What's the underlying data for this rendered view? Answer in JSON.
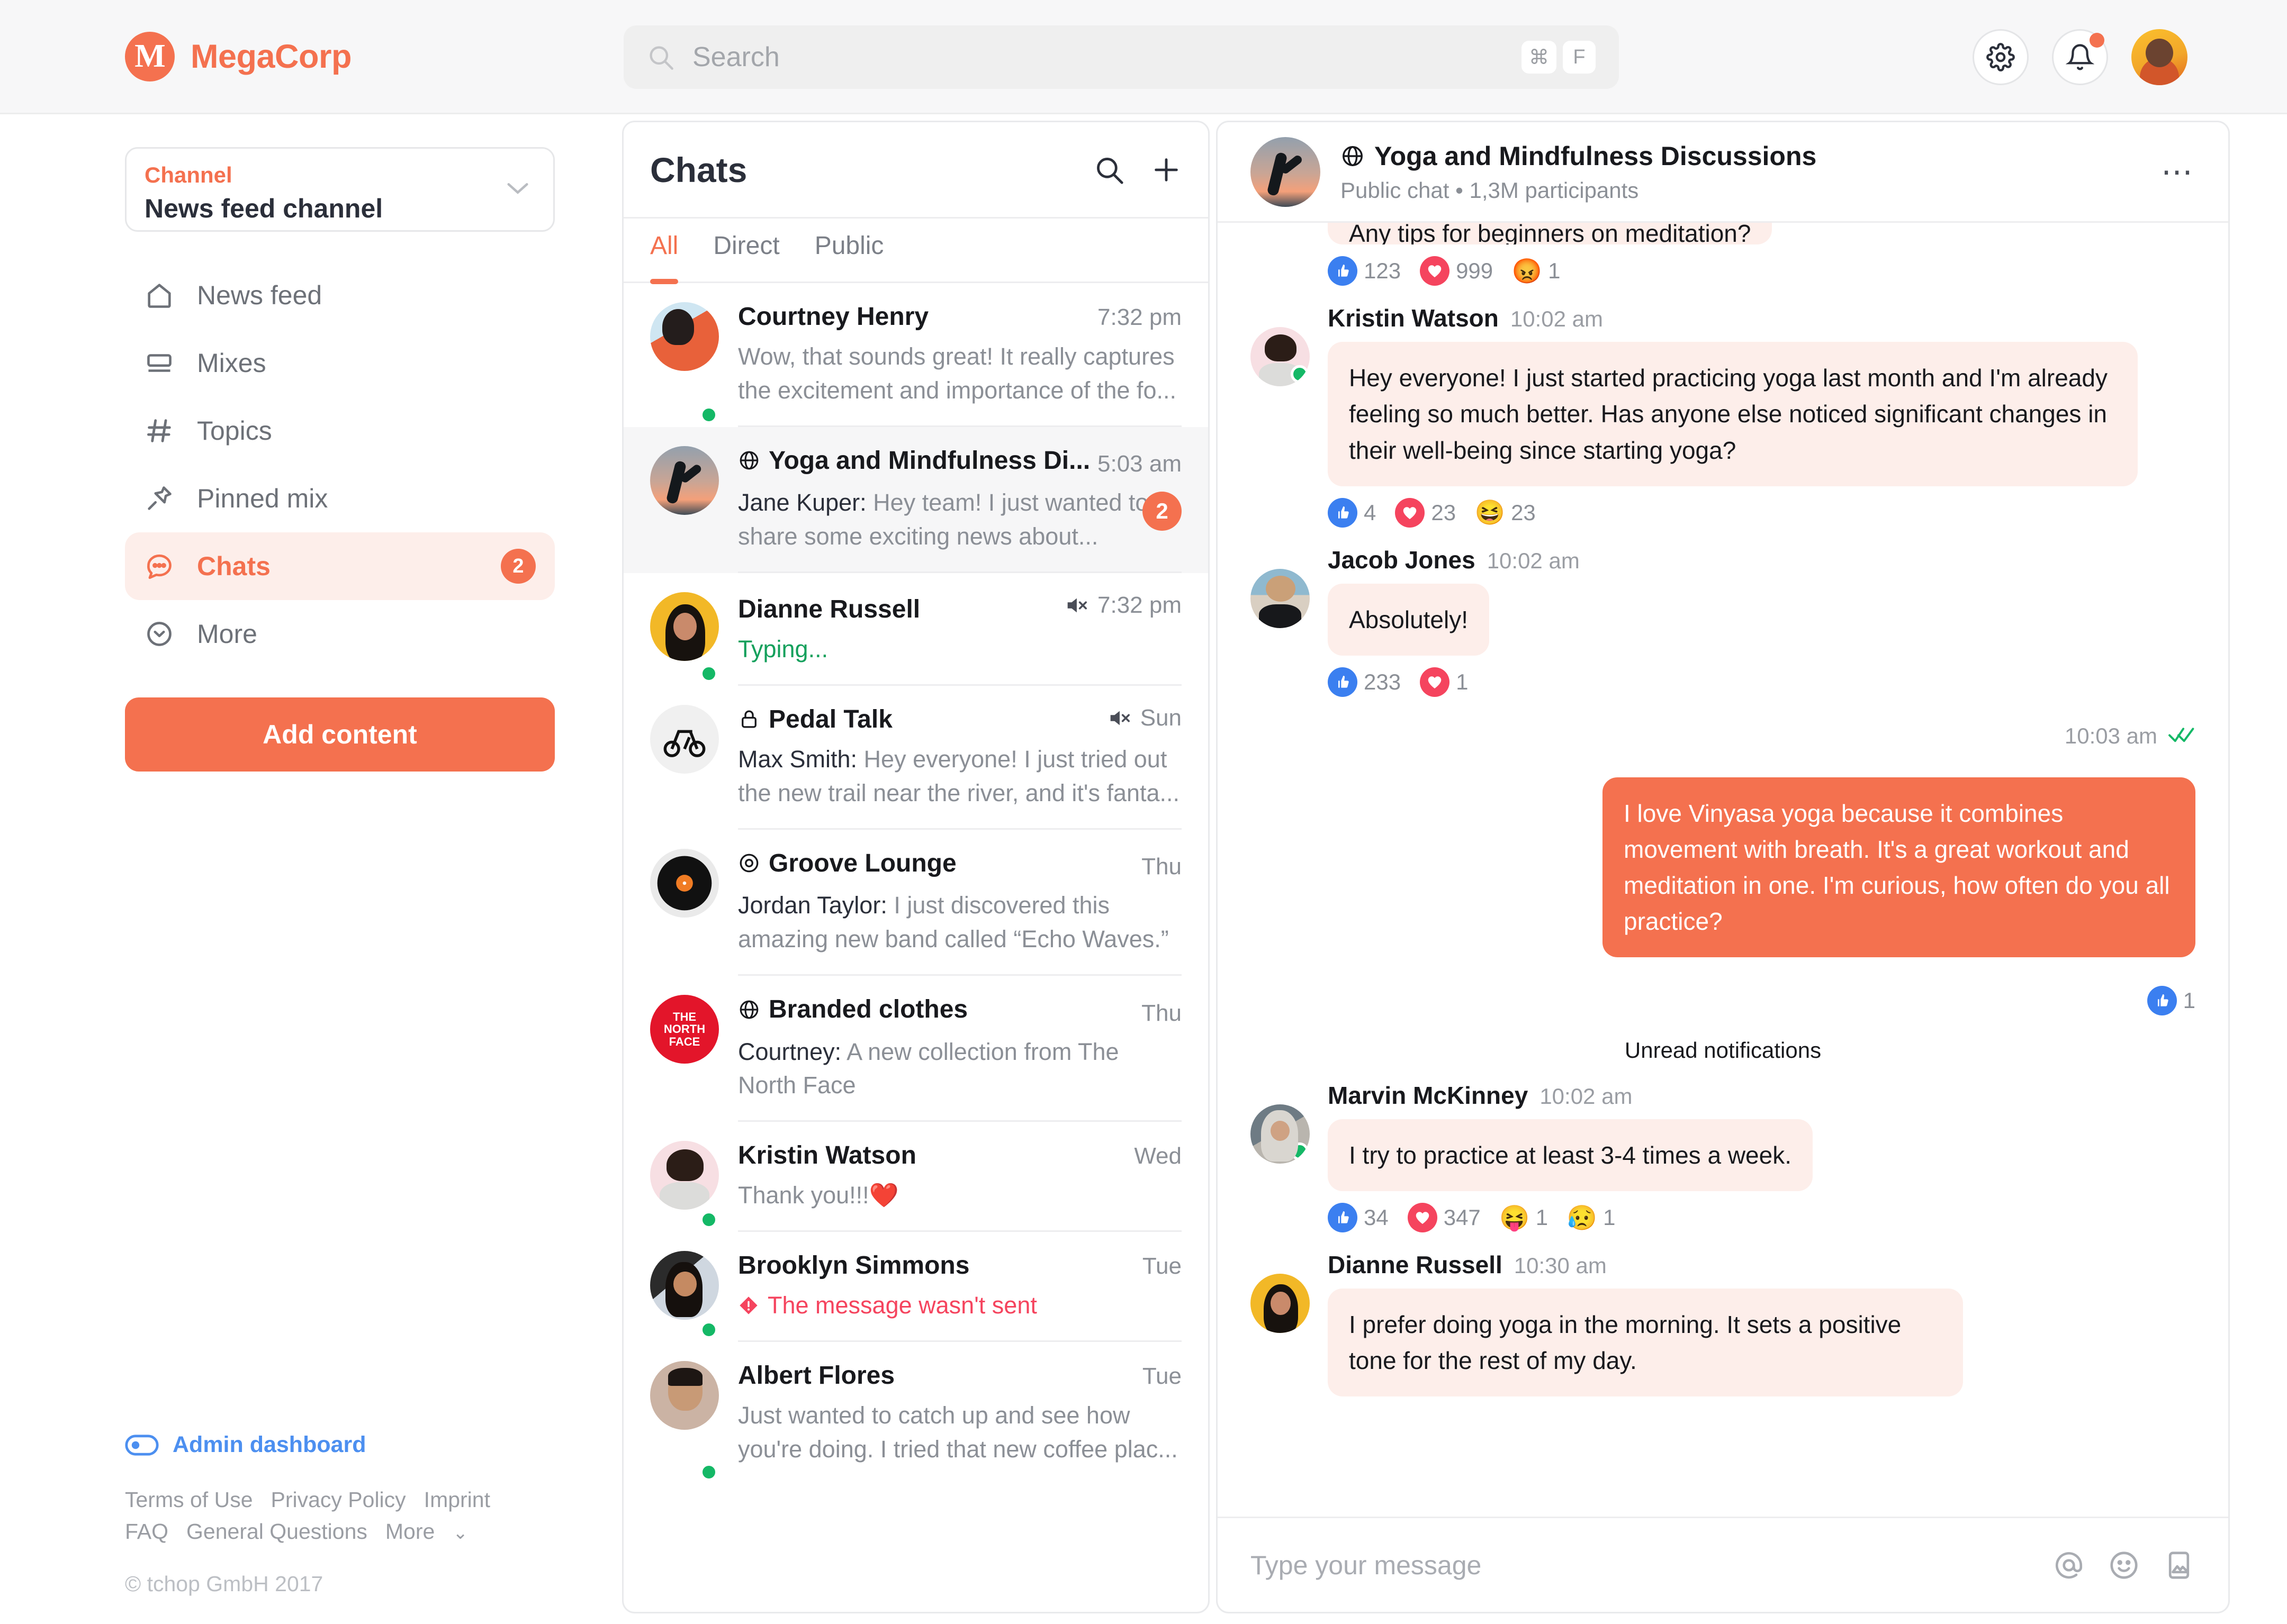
{
  "brand": {
    "mark": "M",
    "name": "MegaCorp"
  },
  "search": {
    "placeholder": "Search",
    "value": "",
    "shortcut_keys": [
      "⌘",
      "F"
    ]
  },
  "topbar": {
    "settings_icon": "gear-icon",
    "notifications_icon": "bell-icon",
    "avatar_label": "User avatar"
  },
  "sidebar": {
    "channel": {
      "label": "Channel",
      "value": "News feed channel"
    },
    "items": [
      {
        "label": "News feed",
        "icon": "home-icon",
        "active": false,
        "count": ""
      },
      {
        "label": "Mixes",
        "icon": "layers-icon",
        "active": false,
        "count": ""
      },
      {
        "label": "Topics",
        "icon": "hash-icon",
        "active": false,
        "count": ""
      },
      {
        "label": "Pinned mix",
        "icon": "pin-icon",
        "active": false,
        "count": ""
      },
      {
        "label": "Chats",
        "icon": "chat-bubble-icon",
        "active": true,
        "count": "2"
      },
      {
        "label": "More",
        "icon": "chevron-down-circle-icon",
        "active": false,
        "count": ""
      }
    ],
    "add_content_label": "Add content",
    "admin_dashboard": "Admin dashboard",
    "legal_links": [
      "Terms of Use",
      "Privacy Policy",
      "Imprint",
      "FAQ",
      "General Questions",
      "More"
    ],
    "copyright": "© tchop GmbH 2017"
  },
  "chatlist": {
    "title": "Chats",
    "tabs": [
      {
        "label": "All",
        "active": true
      },
      {
        "label": "Direct",
        "active": false
      },
      {
        "label": "Public",
        "active": false
      }
    ],
    "rows": [
      {
        "name": "Courtney Henry",
        "time": "7:32 pm",
        "badge_icon": "",
        "sender": "",
        "preview": "Wow, that sounds great! It really captures the excitement and importance of the fo...",
        "online": true,
        "muted": false,
        "unread": "",
        "selected": false,
        "avatar_class": "p-courtney",
        "preview_state": "normal"
      },
      {
        "name": "Yoga and Mindfulness Di...",
        "time": "5:03 am",
        "badge_icon": "globe-icon",
        "sender": "Jane Kuper: ",
        "preview": "Hey team! I just wanted to share some exciting news about...",
        "online": false,
        "muted": false,
        "unread": "2",
        "selected": true,
        "avatar_class": "p-yoga",
        "preview_state": "normal"
      },
      {
        "name": "Dianne Russell",
        "time": "7:32 pm",
        "badge_icon": "",
        "sender": "",
        "preview": "Typing...",
        "online": true,
        "muted": true,
        "unread": "",
        "selected": false,
        "avatar_class": "p-dianne",
        "preview_state": "typing"
      },
      {
        "name": "Pedal Talk",
        "time": "Sun",
        "badge_icon": "lock-icon",
        "sender": "Max Smith: ",
        "preview": "Hey everyone! I just tried out the new trail near the river, and it's fanta...",
        "online": false,
        "muted": true,
        "unread": "",
        "selected": false,
        "avatar_class": "p-bike",
        "preview_state": "normal"
      },
      {
        "name": "Groove Lounge",
        "time": "Thu",
        "badge_icon": "target-icon",
        "sender": "Jordan Taylor: ",
        "preview": "I just discovered this amazing new band called “Echo Waves.”",
        "online": false,
        "muted": false,
        "unread": "",
        "selected": false,
        "avatar_class": "p-vinyl",
        "preview_state": "normal"
      },
      {
        "name": "Branded clothes",
        "time": "Thu",
        "badge_icon": "globe-icon",
        "sender": "Courtney: ",
        "preview": "A new collection from The North Face",
        "online": false,
        "muted": false,
        "unread": "",
        "selected": false,
        "avatar_class": "p-tnf",
        "preview_state": "normal"
      },
      {
        "name": "Kristin Watson",
        "time": "Wed",
        "badge_icon": "",
        "sender": "",
        "preview": "Thank you!!!❤️",
        "online": true,
        "muted": false,
        "unread": "",
        "selected": false,
        "avatar_class": "p-kristin",
        "preview_state": "normal"
      },
      {
        "name": "Brooklyn Simmons",
        "time": "Tue",
        "badge_icon": "",
        "sender": "",
        "preview": "The message wasn't sent",
        "online": true,
        "muted": false,
        "unread": "",
        "selected": false,
        "avatar_class": "p-brooklyn",
        "preview_state": "failed"
      },
      {
        "name": "Albert Flores",
        "time": "Tue",
        "badge_icon": "",
        "sender": "",
        "preview": "Just wanted to catch up and see how you're doing. I tried that new coffee plac...",
        "online": true,
        "muted": false,
        "unread": "",
        "selected": false,
        "avatar_class": "p-albert",
        "preview_state": "normal"
      }
    ]
  },
  "conversation": {
    "title": "Yoga and Mindfulness Discussions",
    "title_icon": "globe-icon",
    "subtitle": "Public chat • 1,3M participants",
    "more_icon": "ellipsis-icon",
    "unread_divider": "Unread notifications",
    "messages": [
      {
        "type": "clipped",
        "author": "",
        "time": "",
        "text": "Any tips for beginners on meditation?",
        "reactions": [
          {
            "emoji": "like",
            "count": "123"
          },
          {
            "emoji": "love",
            "count": "999"
          },
          {
            "emoji": "😡",
            "count": "1"
          }
        ]
      },
      {
        "type": "in",
        "author": "Kristin Watson",
        "time": "10:02 am",
        "avatar_class": "p-kristin",
        "online": true,
        "text": "Hey everyone! I just started practicing yoga last month and I'm already feeling so much better. Has anyone else noticed significant changes in their well-being since starting yoga?",
        "reactions": [
          {
            "emoji": "like",
            "count": "4"
          },
          {
            "emoji": "love",
            "count": "23"
          },
          {
            "emoji": "😆",
            "count": "23"
          }
        ]
      },
      {
        "type": "in",
        "author": "Jacob Jones",
        "time": "10:02 am",
        "avatar_class": "p-jacob",
        "online": false,
        "text": "Absolutely!",
        "reactions": [
          {
            "emoji": "like",
            "count": "233"
          },
          {
            "emoji": "love",
            "count": "1"
          }
        ]
      },
      {
        "type": "out",
        "author": "",
        "time": "10:03 am",
        "status": "read",
        "text": "I love Vinyasa yoga because it combines movement with breath. It's a great workout and meditation in one. I'm curious, how often do you all practice?",
        "reactions": [
          {
            "emoji": "like",
            "count": "1"
          }
        ]
      },
      {
        "type": "in",
        "author": "Marvin McKinney",
        "time": "10:02 am",
        "avatar_class": "p-marvin",
        "online": true,
        "text": "I try to practice at least 3-4 times a week.",
        "reactions": [
          {
            "emoji": "like",
            "count": "34"
          },
          {
            "emoji": "love",
            "count": "347"
          },
          {
            "emoji": "😝",
            "count": "1"
          },
          {
            "emoji": "😥",
            "count": "1"
          }
        ]
      },
      {
        "type": "in",
        "author": "Dianne Russell",
        "time": "10:30 am",
        "avatar_class": "p-dianne",
        "online": false,
        "text": "I prefer doing yoga in the morning. It sets a positive tone for the rest of my day.",
        "reactions": []
      }
    ],
    "composer": {
      "placeholder": "Type your message",
      "value": "",
      "actions": [
        "mention-icon",
        "emoji-icon",
        "image-icon"
      ]
    }
  },
  "colors": {
    "accent": "#f4714f",
    "bubble_in": "#fdeeea",
    "online": "#14b866",
    "error": "#f5445e",
    "link": "#4c8ff0"
  }
}
